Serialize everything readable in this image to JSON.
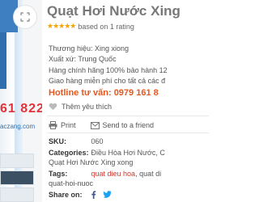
{
  "product": {
    "title": "Quạt Hơi Nước Xing",
    "rating_stars": "★★★★★",
    "rating_text": "based on 1 rating",
    "brand": "Thương hiệu: Xing xiong",
    "origin": "Xuất xứ: Trung Quốc",
    "warranty": "Hàng chính hãng 100% bảo hành 12",
    "shipping": "Giao hàng miễn phí cho tất cả các đ",
    "hotline": "Hotline tư vấn: 0979 161 8"
  },
  "image_overlay": {
    "hotline_fragment": "61 822",
    "domain_fragment": "aczang.com"
  },
  "actions": {
    "like_label": "Thêm yêu thích",
    "print_label": "Print",
    "send_label": "Send to a friend"
  },
  "meta": {
    "sku_key": "SKU:",
    "sku_value": "060",
    "categories_key": "Categories:",
    "categories_value": "Điều Hòa Hơi Nước, C",
    "categories_value2": "Quạt Hơi Nước Xing xong",
    "tags_key": "Tags:",
    "tags_value1": "quat dieu hoa",
    "tags_value2": ", quat di",
    "tags_value3": "quat-hoi-nuoc",
    "share_key": "Share on:"
  },
  "colors": {
    "accent": "#e8571d",
    "link": "#d3372f",
    "star": "#f0a500"
  }
}
